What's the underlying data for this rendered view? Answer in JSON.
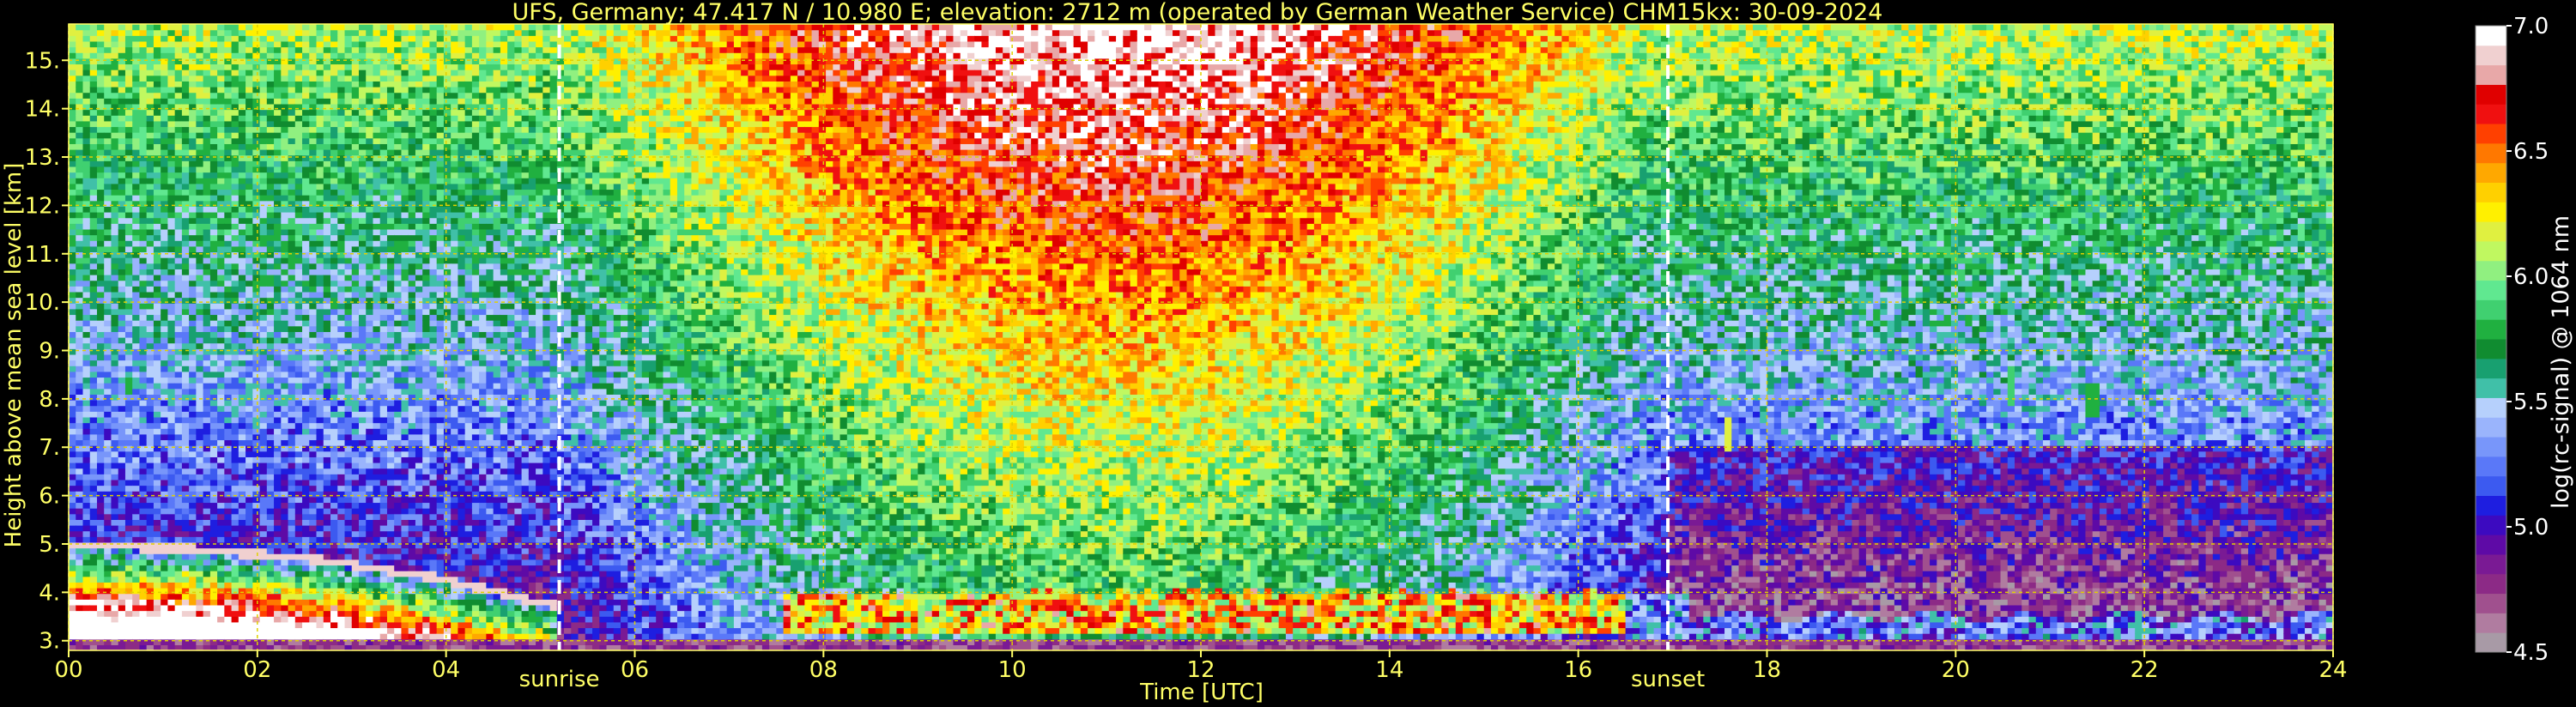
{
  "chart_data": {
    "type": "heatmap",
    "title": "UFS, Germany; 47.417 N / 10.980 E; elevation: 2712 m  (operated by German Weather Service)     CHM15kx: 30-09-2024",
    "xlabel": "Time [UTC]",
    "ylabel": "Height above mean sea level [km]",
    "xlim": [
      0,
      24
    ],
    "ylim": [
      2.8,
      15.75
    ],
    "x_ticks": [
      "00",
      "02",
      "04",
      "06",
      "08",
      "10",
      "12",
      "14",
      "16",
      "18",
      "20",
      "22",
      "24"
    ],
    "y_ticks": [
      "3.",
      "4.",
      "5.",
      "6.",
      "7.",
      "8.",
      "9.",
      "10.",
      "11.",
      "12.",
      "13.",
      "14.",
      "15."
    ],
    "grid": true,
    "markers": [
      {
        "label": "sunrise",
        "time": 5.2
      },
      {
        "label": "sunset",
        "time": 16.95
      }
    ],
    "colorbar": {
      "label": "log(rc-signal) @ 1064 nm",
      "range": [
        4.5,
        7.0
      ],
      "ticks": [
        "4.5",
        "5.0",
        "5.5",
        "6.0",
        "6.5",
        "7.0"
      ],
      "colors": [
        "#a89aa6",
        "#b07ca0",
        "#a0508e",
        "#8c2a86",
        "#7a1a94",
        "#5e0aa6",
        "#3c0ac0",
        "#1e1ee0",
        "#3c5af0",
        "#5a78f8",
        "#7896fa",
        "#9ab4fc",
        "#b6d0fc",
        "#40c0a8",
        "#18a070",
        "#108c30",
        "#20b040",
        "#40d070",
        "#60e890",
        "#90f080",
        "#c0f860",
        "#e0f040",
        "#fff000",
        "#ffd000",
        "#ffa800",
        "#ff7800",
        "#ff4000",
        "#f01010",
        "#e00000",
        "#e8a8a8",
        "#f0d0d0",
        "#ffffff"
      ]
    },
    "features": {
      "ground_layer_km": 3.0,
      "morning_layer_top_km": [
        5.0,
        4.9,
        4.7,
        4.3,
        3.7
      ],
      "daytime_boundary_layer_top_km": 4.0,
      "cirrus_patches_km": [
        8.2,
        7.3,
        8.3,
        8.0
      ]
    }
  }
}
